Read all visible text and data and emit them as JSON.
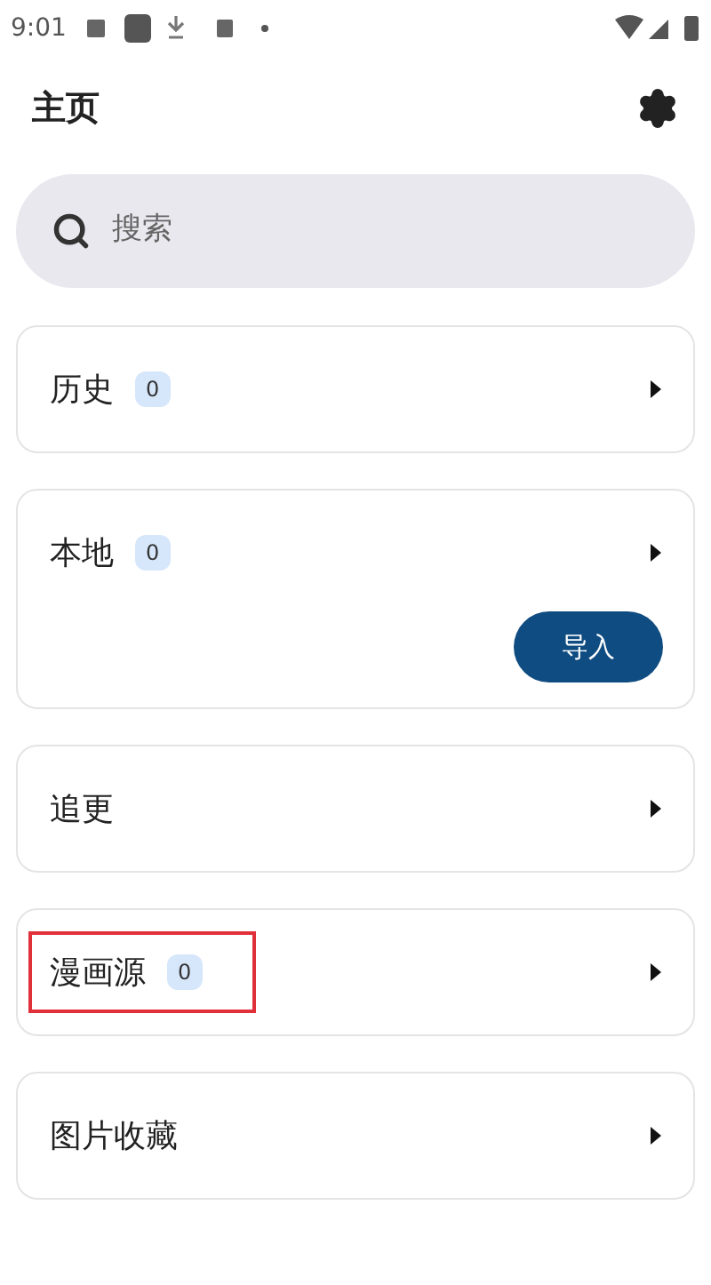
{
  "status_bar": {
    "time": "9:01"
  },
  "header": {
    "title": "主页"
  },
  "search": {
    "placeholder": "搜索"
  },
  "cards": [
    {
      "label": "历史",
      "count": "0",
      "highlighted": false
    },
    {
      "label": "本地",
      "count": "0",
      "button": "导入",
      "highlighted": false
    },
    {
      "label": "追更",
      "highlighted": false
    },
    {
      "label": "漫画源",
      "count": "0",
      "highlighted": true
    },
    {
      "label": "图片收藏",
      "highlighted": false
    }
  ]
}
